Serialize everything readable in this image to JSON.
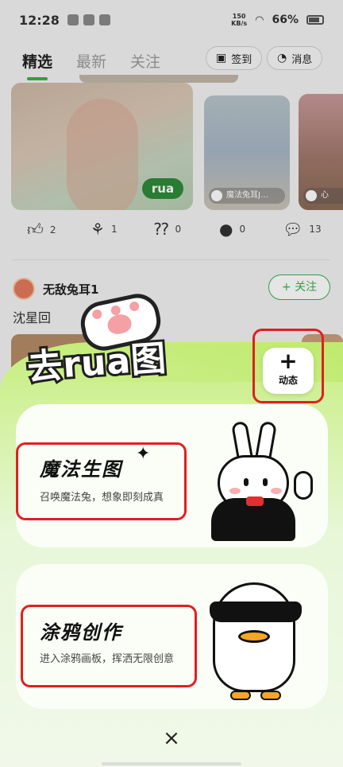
{
  "status_bar": {
    "time": "12:28",
    "net_speed_value": "150",
    "net_speed_unit": "KB/s",
    "battery": "66%"
  },
  "header": {
    "tabs": [
      "精选",
      "最新",
      "关注"
    ],
    "checkin_label": "签到",
    "messages_label": "消息"
  },
  "feed": {
    "cards": [
      {
        "stamp": "rua"
      },
      {
        "caption": "魔法兔耳J…"
      },
      {
        "caption": "心"
      }
    ],
    "reactions": [
      {
        "icon": "thumbs-up-icon",
        "count": "2"
      },
      {
        "icon": "rose-icon",
        "count": "1"
      },
      {
        "icon": "question-icon",
        "count": "0"
      },
      {
        "icon": "bomb-icon",
        "count": "0"
      },
      {
        "icon": "comment-icon",
        "count": "13"
      }
    ],
    "post": {
      "username": "无敌兔耳1",
      "follow_label": "+ 关注",
      "text": "沈星回"
    }
  },
  "sheet": {
    "brand": "去rua图",
    "post_button": {
      "plus": "+",
      "label": "动态"
    },
    "options": [
      {
        "title": "魔法生图",
        "desc": "召唤魔法兔，想象即刻成真"
      },
      {
        "title": "涂鸦创作",
        "desc": "进入涂鸦画板，挥洒无限创意"
      }
    ],
    "close": "×"
  },
  "colors": {
    "accent_green": "#37b24d",
    "highlight_red": "#e02020",
    "sheet_top": "#c7ee7e"
  }
}
